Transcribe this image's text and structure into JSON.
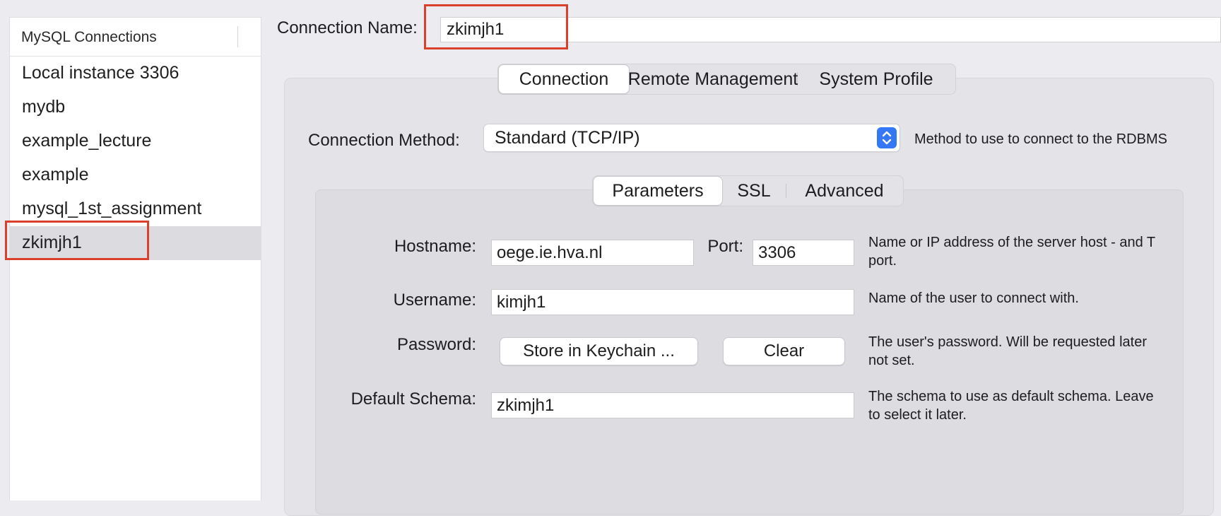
{
  "sidebar": {
    "title": "MySQL Connections",
    "items": [
      {
        "label": "Local instance 3306"
      },
      {
        "label": "mydb"
      },
      {
        "label": "example_lecture"
      },
      {
        "label": "example"
      },
      {
        "label": "mysql_1st_assignment"
      },
      {
        "label": "zkimjh1",
        "selected": true
      }
    ]
  },
  "connection_name": {
    "label": "Connection Name:",
    "value": "zkimjh1"
  },
  "main_tabs": [
    {
      "label": "Connection",
      "active": true
    },
    {
      "label": "Remote Management"
    },
    {
      "label": "System Profile"
    }
  ],
  "connection_method": {
    "label": "Connection Method:",
    "value": "Standard (TCP/IP)",
    "help": "Method to use to connect to the RDBMS"
  },
  "sub_tabs": [
    {
      "label": "Parameters",
      "active": true
    },
    {
      "label": "SSL"
    },
    {
      "label": "Advanced"
    }
  ],
  "params": {
    "hostname": {
      "label": "Hostname:",
      "value": "oege.ie.hva.nl"
    },
    "port": {
      "label": "Port:",
      "value": "3306"
    },
    "hostname_help": [
      "Name or IP address of the server host - and T",
      "port."
    ],
    "username": {
      "label": "Username:",
      "value": "kimjh1",
      "help": "Name of the user to connect with."
    },
    "password": {
      "label": "Password:",
      "store_button": "Store in Keychain ...",
      "clear_button": "Clear",
      "help": [
        "The user's password. Will be requested later",
        "not set."
      ]
    },
    "default_schema": {
      "label": "Default Schema:",
      "value": "zkimjh1",
      "help": [
        "The schema to use as default schema. Leave",
        "to select it later."
      ]
    }
  },
  "colors": {
    "highlight": "#d9412d",
    "accent": "#3478f6"
  }
}
